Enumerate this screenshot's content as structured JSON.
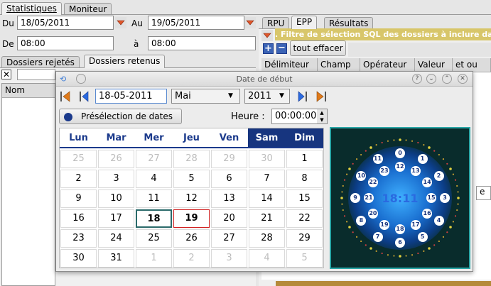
{
  "tabs": {
    "statistiques": "Statistiques",
    "moniteur": "Moniteur"
  },
  "filters": {
    "du_label": "Du",
    "du_value": "18/05/2011",
    "au_label": "Au",
    "au_value": "19/05/2011",
    "de_label": "De",
    "de_value": "08:00",
    "a_label": "à",
    "a_value": "08:00"
  },
  "left_tabs": {
    "rejetes": "Dossiers rejetés",
    "retenus": "Dossiers retenus"
  },
  "left_table": {
    "nom_header": "Nom"
  },
  "right_tabs": {
    "rpu": "RPU",
    "epp": "EPP",
    "resultats": "Résultats"
  },
  "sql_filter_text": ". Filtre de sélection SQL des dossiers à inclure dans",
  "toolbar": {
    "clear_all": "tout effacer"
  },
  "right_table": {
    "headers": [
      "Délimiteur",
      "Champ",
      "Opérateur",
      "Valeur",
      "et ou"
    ]
  },
  "right_partial_text": "e",
  "dialog": {
    "title": "Date de début",
    "date_value": "18-05-2011",
    "month_value": "Mai",
    "year_value": "2011",
    "preselection_label": "Présélection de dates",
    "hour_label": "Heure :",
    "hour_value": "00:00:00"
  },
  "calendar": {
    "weekdays": [
      "Lun",
      "Mar",
      "Mer",
      "Jeu",
      "Ven",
      "Sam",
      "Dim"
    ],
    "weeks": [
      [
        "25",
        "26",
        "27",
        "28",
        "29",
        "30",
        "1"
      ],
      [
        "2",
        "3",
        "4",
        "5",
        "6",
        "7",
        "8"
      ],
      [
        "9",
        "10",
        "11",
        "12",
        "13",
        "14",
        "15"
      ],
      [
        "16",
        "17",
        "18",
        "19",
        "20",
        "21",
        "22"
      ],
      [
        "23",
        "24",
        "25",
        "26",
        "27",
        "28",
        "29"
      ],
      [
        "30",
        "31",
        "1",
        "2",
        "3",
        "4",
        "5"
      ]
    ],
    "today": "18",
    "selected": "19"
  },
  "clock": {
    "time": "18:11",
    "outer_numbers": [
      "0",
      "1",
      "2",
      "3",
      "4",
      "5",
      "6",
      "7",
      "8",
      "9",
      "10",
      "11"
    ],
    "inner_numbers": [
      "12",
      "13",
      "14",
      "15",
      "16",
      "17",
      "18",
      "19",
      "20",
      "21",
      "22",
      "23"
    ]
  },
  "colors": {
    "accent_blue": "#17357f",
    "sql_bar": "#d8c66a",
    "clock_glow": "#2a8fe0",
    "today_border": "#2a6a6a",
    "selected_border": "#d02020"
  }
}
